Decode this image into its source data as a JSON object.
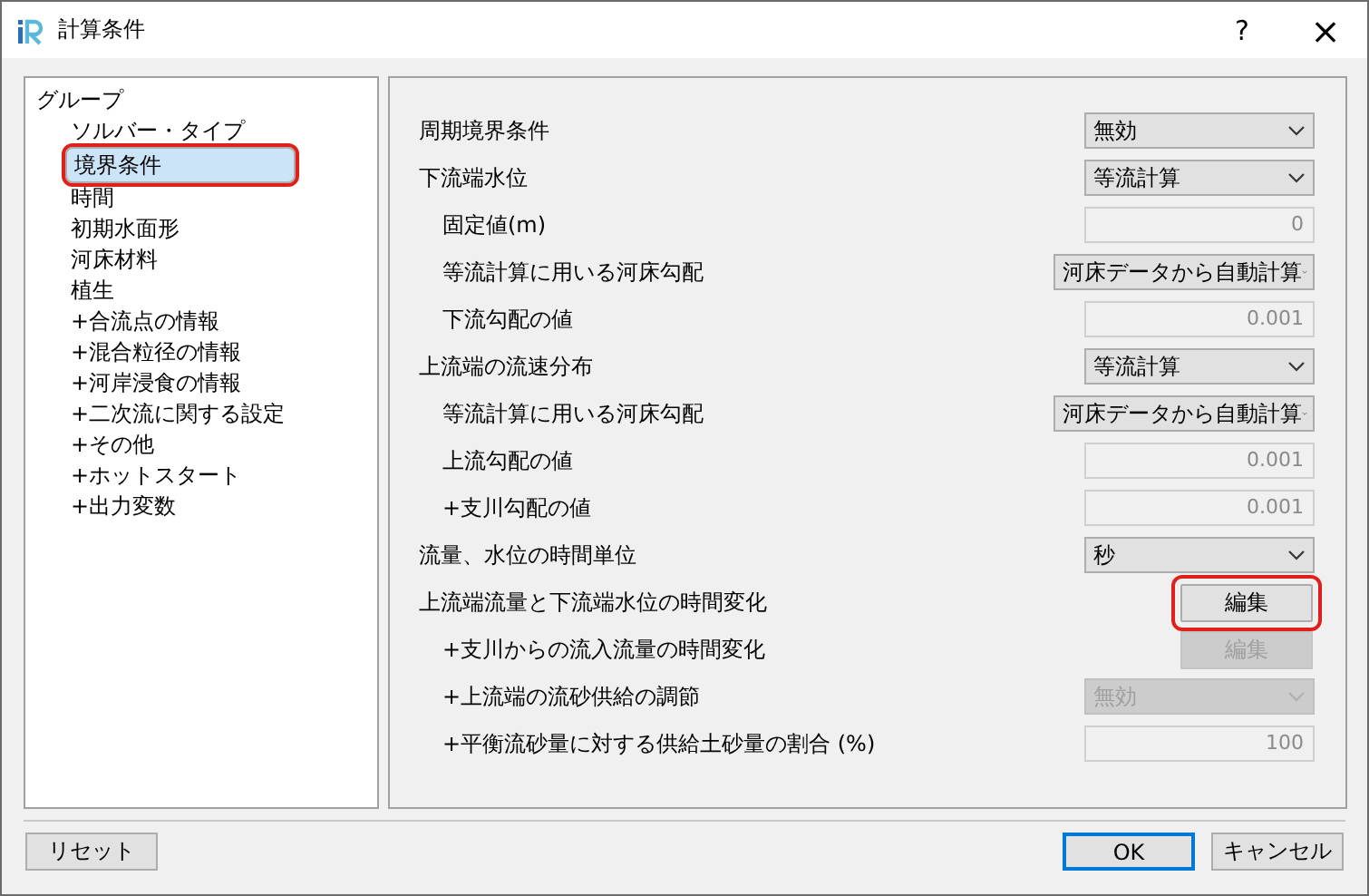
{
  "window": {
    "title": "計算条件",
    "help": "?",
    "close": "×"
  },
  "tree": {
    "root": "グループ",
    "items": [
      {
        "label": "ソルバー・タイプ",
        "selected": false
      },
      {
        "label": "境界条件",
        "selected": true,
        "highlighted": true
      },
      {
        "label": "時間",
        "selected": false
      },
      {
        "label": "初期水面形",
        "selected": false
      },
      {
        "label": "河床材料",
        "selected": false
      },
      {
        "label": "植生",
        "selected": false
      },
      {
        "label": "+合流点の情報",
        "selected": false
      },
      {
        "label": "+混合粒径の情報",
        "selected": false
      },
      {
        "label": "+河岸浸食の情報",
        "selected": false
      },
      {
        "label": "+二次流に関する設定",
        "selected": false
      },
      {
        "label": "+その他",
        "selected": false
      },
      {
        "label": "+ホットスタート",
        "selected": false
      },
      {
        "label": "+出力変数",
        "selected": false
      }
    ]
  },
  "settings": [
    {
      "label": "周期境界条件",
      "kind": "select",
      "value": "無効",
      "indented": false,
      "disabled": false
    },
    {
      "label": "下流端水位",
      "kind": "select",
      "value": "等流計算",
      "indented": false,
      "disabled": false
    },
    {
      "label": "固定値(m)",
      "kind": "input",
      "value": "0",
      "indented": true,
      "disabled": true
    },
    {
      "label": "等流計算に用いる河床勾配",
      "kind": "select",
      "value": "河床データから自動計算",
      "indented": true,
      "disabled": false,
      "wide": true
    },
    {
      "label": "下流勾配の値",
      "kind": "input",
      "value": "0.001",
      "indented": true,
      "disabled": true
    },
    {
      "label": "上流端の流速分布",
      "kind": "select",
      "value": "等流計算",
      "indented": false,
      "disabled": false
    },
    {
      "label": "等流計算に用いる河床勾配",
      "kind": "select",
      "value": "河床データから自動計算",
      "indented": true,
      "disabled": false,
      "wide": true
    },
    {
      "label": "上流勾配の値",
      "kind": "input",
      "value": "0.001",
      "indented": true,
      "disabled": true
    },
    {
      "label": " +支川勾配の値",
      "kind": "input",
      "value": "0.001",
      "indented": true,
      "disabled": true
    },
    {
      "label": "流量、水位の時間単位",
      "kind": "select",
      "value": "秒",
      "indented": false,
      "disabled": false
    },
    {
      "label": "上流端流量と下流端水位の時間変化",
      "kind": "button",
      "value": "編集",
      "indented": false,
      "disabled": false,
      "highlighted": true
    },
    {
      "label": "+支川からの流入流量の時間変化",
      "kind": "button",
      "value": "編集",
      "indented": true,
      "disabled": true
    },
    {
      "label": "+上流端の流砂供給の調節",
      "kind": "select",
      "value": "無効",
      "indented": true,
      "disabled": true
    },
    {
      "label": "+平衡流砂量に対する供給土砂量の割合 (%)",
      "kind": "input",
      "value": "100",
      "indented": true,
      "disabled": true
    }
  ],
  "footer": {
    "reset": "リセット",
    "ok": "OK",
    "cancel": "キャンセル"
  }
}
